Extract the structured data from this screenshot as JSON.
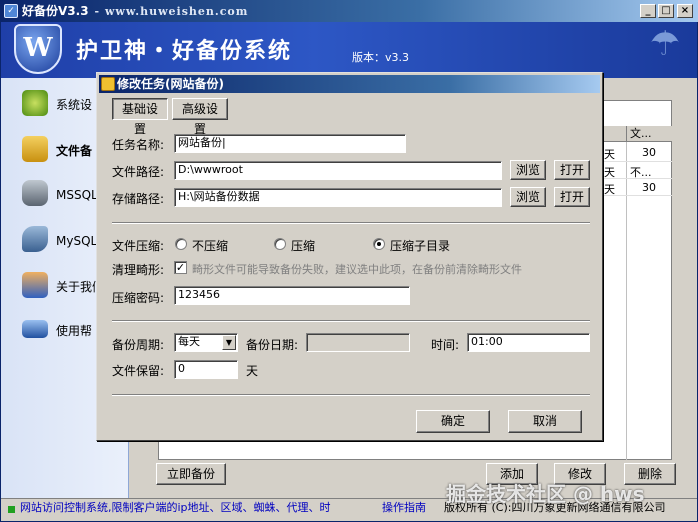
{
  "window": {
    "title": "好备份V3.3",
    "title_url": "- www.huweishen.com",
    "minimize": "_",
    "maximize": "□",
    "close": "×"
  },
  "banner": {
    "logo_letter": "W",
    "app_name": "护卫神・好备份系统",
    "version": "版本：v3.3"
  },
  "sidebar": {
    "items": [
      {
        "label": "系统设",
        "icon": "gear-icon"
      },
      {
        "label": "文件备",
        "icon": "folder-arrow-icon"
      },
      {
        "label": "MSSQL备",
        "icon": "database-icon"
      },
      {
        "label": "MySQL备",
        "icon": "dolphin-icon"
      },
      {
        "label": "关于我们",
        "icon": "users-icon"
      },
      {
        "label": "使用帮",
        "icon": "book-icon"
      }
    ]
  },
  "background_table": {
    "header": "文...",
    "rows": [
      {
        "flag": "天",
        "value": "30"
      },
      {
        "flag": "天",
        "value": "不..."
      },
      {
        "flag": "天",
        "value": "30"
      }
    ]
  },
  "background_buttons": {
    "backup_now": "立即备份",
    "add": "添加",
    "edit": "修改",
    "delete": "删除"
  },
  "statusbar": {
    "marquee": "网站访问控制系统,限制客户端的ip地址、区域、蜘蛛、代理、时",
    "guide": "操作指南",
    "copyright": "版权所有 (C):四川万象更新网络通信有限公司",
    "watermark": "掘金技术社区 @ hws"
  },
  "dialog": {
    "title": "修改任务(网站备份)",
    "tabs": {
      "basic": "基础设置",
      "advanced": "高级设置"
    },
    "task_name": {
      "label": "任务名称:",
      "value": "网站备份|"
    },
    "file_path": {
      "label": "文件路径:",
      "value": "D:\\wwwroot",
      "browse": "浏览",
      "open": "打开"
    },
    "storage_path": {
      "label": "存储路径:",
      "value": "H:\\网站备份数据",
      "browse": "浏览",
      "open": "打开"
    },
    "compression": {
      "label": "文件压缩:",
      "options": [
        "不压缩",
        "压缩",
        "压缩子目录"
      ],
      "selected": "压缩子目录"
    },
    "clean_deformed": {
      "label": "清理畸形:",
      "checked": true,
      "text": "畸形文件可能导致备份失败，建议选中此项，在备份前清除畸形文件"
    },
    "zip_password": {
      "label": "压缩密码:",
      "value": "123456"
    },
    "schedule": {
      "cycle_label": "备份周期:",
      "cycle_value": "每天",
      "date_label": "备份日期:",
      "date_value": "",
      "time_label": "时间:",
      "time_value": "01:00"
    },
    "retention": {
      "label": "文件保留:",
      "value": "0",
      "unit": "天"
    },
    "ok": "确定",
    "cancel": "取消"
  }
}
